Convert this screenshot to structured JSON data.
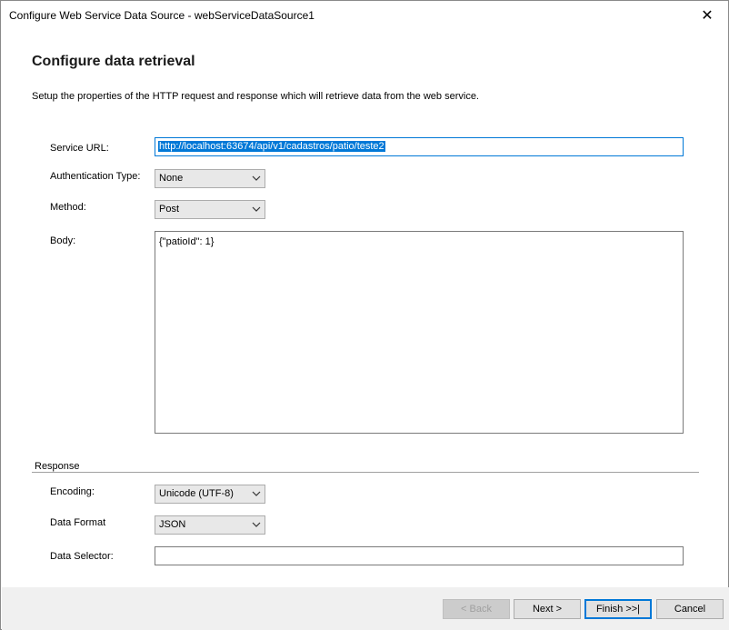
{
  "window": {
    "title": "Configure Web Service Data Source - webServiceDataSource1",
    "close_glyph": "✕"
  },
  "page": {
    "heading": "Configure data retrieval",
    "description": "Setup the properties of the HTTP request and response which will retrieve data from the web service."
  },
  "request": {
    "service_url_label": "Service URL:",
    "service_url_value": "http://localhost:63674/api/v1/cadastros/patio/teste2",
    "auth_type_label": "Authentication Type:",
    "auth_type_value": "None",
    "method_label": "Method:",
    "method_value": "Post",
    "body_label": "Body:",
    "body_value": "{\"patioId\": 1}"
  },
  "response": {
    "section_label": "Response",
    "encoding_label": "Encoding:",
    "encoding_value": "Unicode (UTF-8)",
    "data_format_label": "Data Format",
    "data_format_value": "JSON",
    "data_selector_label": "Data Selector:",
    "data_selector_value": ""
  },
  "buttons": {
    "back": "< Back",
    "next": "Next >",
    "finish": "Finish >>|",
    "cancel": "Cancel"
  },
  "icons": {
    "close": "close-icon",
    "dropdown": "chevron-down-icon"
  }
}
